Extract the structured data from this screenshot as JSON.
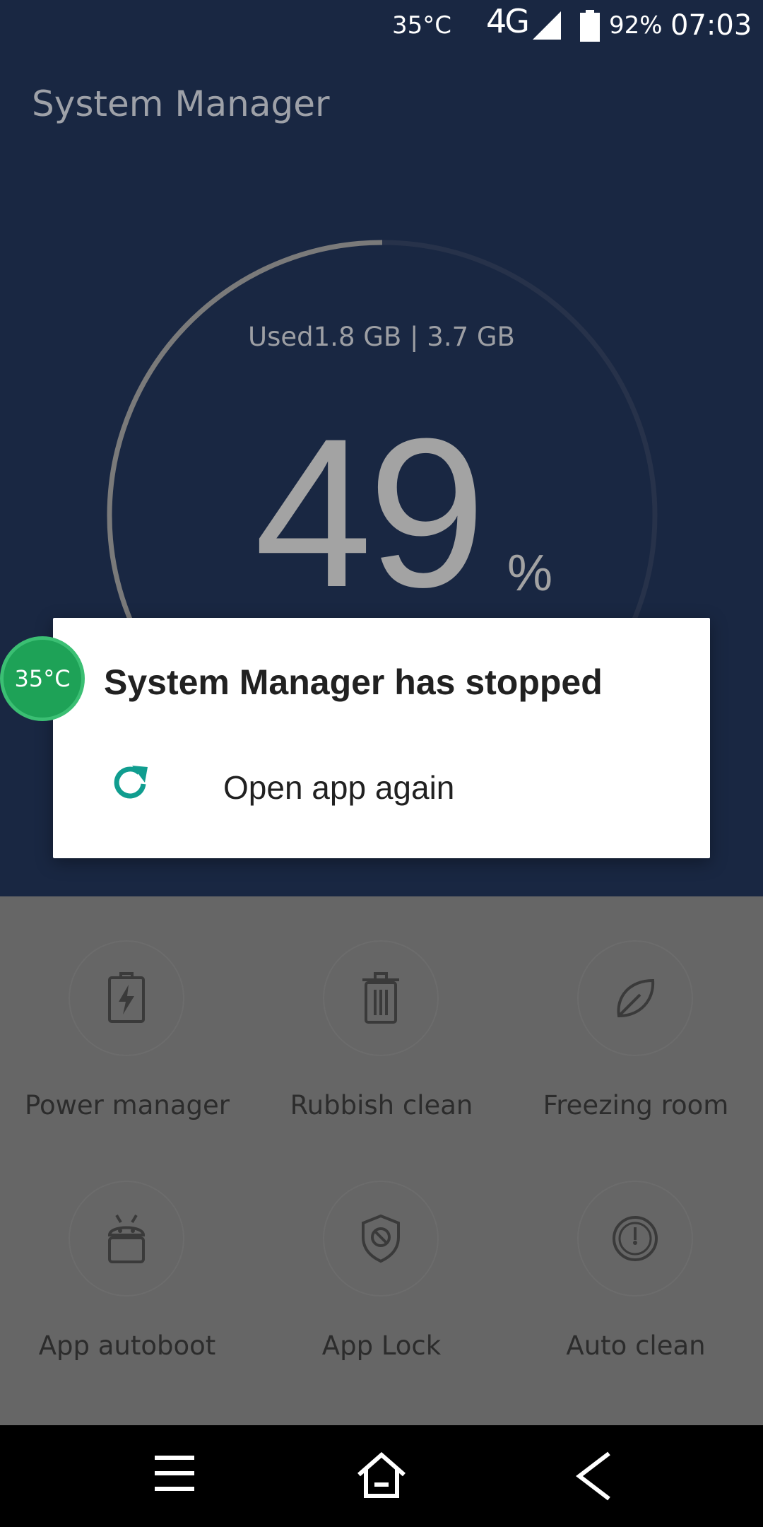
{
  "status_bar": {
    "temperature": "35°C",
    "network": "4G",
    "battery_percent": "92%",
    "time": "07:03",
    "signal_icon": "cell-signal-icon",
    "battery_icon": "battery-icon"
  },
  "app": {
    "title": "System Manager",
    "memory": {
      "used_text": "Used1.8 GB | 3.7 GB",
      "percent_value": "49",
      "percent_sign": "%",
      "fraction": 0.49
    }
  },
  "features": [
    {
      "label": "Power manager",
      "icon": "battery-charging-icon"
    },
    {
      "label": "Rubbish clean",
      "icon": "trash-icon"
    },
    {
      "label": "Freezing room",
      "icon": "leaf-icon"
    },
    {
      "label": "App autoboot",
      "icon": "android-icon"
    },
    {
      "label": "App Lock",
      "icon": "shield-block-icon"
    },
    {
      "label": "Auto clean",
      "icon": "gauge-icon"
    }
  ],
  "dialog": {
    "title": "System Manager has stopped",
    "option_label": "Open app again",
    "option_icon": "refresh-icon",
    "accent_color": "#109d8f"
  },
  "floating_bubble": {
    "temperature": "35°C",
    "color": "#1ea257"
  },
  "nav_bar": {
    "icons": [
      "menu-icon",
      "home-icon",
      "back-icon"
    ]
  }
}
